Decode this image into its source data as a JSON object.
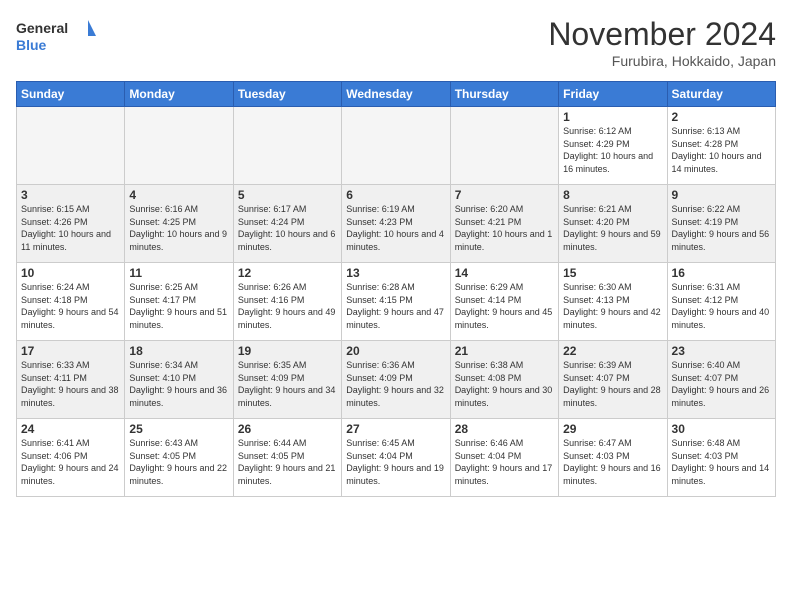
{
  "header": {
    "logo_line1": "General",
    "logo_line2": "Blue",
    "month": "November 2024",
    "location": "Furubira, Hokkaido, Japan"
  },
  "days_of_week": [
    "Sunday",
    "Monday",
    "Tuesday",
    "Wednesday",
    "Thursday",
    "Friday",
    "Saturday"
  ],
  "weeks": [
    [
      {
        "day": "",
        "info": ""
      },
      {
        "day": "",
        "info": ""
      },
      {
        "day": "",
        "info": ""
      },
      {
        "day": "",
        "info": ""
      },
      {
        "day": "",
        "info": ""
      },
      {
        "day": "1",
        "info": "Sunrise: 6:12 AM\nSunset: 4:29 PM\nDaylight: 10 hours and 16 minutes."
      },
      {
        "day": "2",
        "info": "Sunrise: 6:13 AM\nSunset: 4:28 PM\nDaylight: 10 hours and 14 minutes."
      }
    ],
    [
      {
        "day": "3",
        "info": "Sunrise: 6:15 AM\nSunset: 4:26 PM\nDaylight: 10 hours and 11 minutes."
      },
      {
        "day": "4",
        "info": "Sunrise: 6:16 AM\nSunset: 4:25 PM\nDaylight: 10 hours and 9 minutes."
      },
      {
        "day": "5",
        "info": "Sunrise: 6:17 AM\nSunset: 4:24 PM\nDaylight: 10 hours and 6 minutes."
      },
      {
        "day": "6",
        "info": "Sunrise: 6:19 AM\nSunset: 4:23 PM\nDaylight: 10 hours and 4 minutes."
      },
      {
        "day": "7",
        "info": "Sunrise: 6:20 AM\nSunset: 4:21 PM\nDaylight: 10 hours and 1 minute."
      },
      {
        "day": "8",
        "info": "Sunrise: 6:21 AM\nSunset: 4:20 PM\nDaylight: 9 hours and 59 minutes."
      },
      {
        "day": "9",
        "info": "Sunrise: 6:22 AM\nSunset: 4:19 PM\nDaylight: 9 hours and 56 minutes."
      }
    ],
    [
      {
        "day": "10",
        "info": "Sunrise: 6:24 AM\nSunset: 4:18 PM\nDaylight: 9 hours and 54 minutes."
      },
      {
        "day": "11",
        "info": "Sunrise: 6:25 AM\nSunset: 4:17 PM\nDaylight: 9 hours and 51 minutes."
      },
      {
        "day": "12",
        "info": "Sunrise: 6:26 AM\nSunset: 4:16 PM\nDaylight: 9 hours and 49 minutes."
      },
      {
        "day": "13",
        "info": "Sunrise: 6:28 AM\nSunset: 4:15 PM\nDaylight: 9 hours and 47 minutes."
      },
      {
        "day": "14",
        "info": "Sunrise: 6:29 AM\nSunset: 4:14 PM\nDaylight: 9 hours and 45 minutes."
      },
      {
        "day": "15",
        "info": "Sunrise: 6:30 AM\nSunset: 4:13 PM\nDaylight: 9 hours and 42 minutes."
      },
      {
        "day": "16",
        "info": "Sunrise: 6:31 AM\nSunset: 4:12 PM\nDaylight: 9 hours and 40 minutes."
      }
    ],
    [
      {
        "day": "17",
        "info": "Sunrise: 6:33 AM\nSunset: 4:11 PM\nDaylight: 9 hours and 38 minutes."
      },
      {
        "day": "18",
        "info": "Sunrise: 6:34 AM\nSunset: 4:10 PM\nDaylight: 9 hours and 36 minutes."
      },
      {
        "day": "19",
        "info": "Sunrise: 6:35 AM\nSunset: 4:09 PM\nDaylight: 9 hours and 34 minutes."
      },
      {
        "day": "20",
        "info": "Sunrise: 6:36 AM\nSunset: 4:09 PM\nDaylight: 9 hours and 32 minutes."
      },
      {
        "day": "21",
        "info": "Sunrise: 6:38 AM\nSunset: 4:08 PM\nDaylight: 9 hours and 30 minutes."
      },
      {
        "day": "22",
        "info": "Sunrise: 6:39 AM\nSunset: 4:07 PM\nDaylight: 9 hours and 28 minutes."
      },
      {
        "day": "23",
        "info": "Sunrise: 6:40 AM\nSunset: 4:07 PM\nDaylight: 9 hours and 26 minutes."
      }
    ],
    [
      {
        "day": "24",
        "info": "Sunrise: 6:41 AM\nSunset: 4:06 PM\nDaylight: 9 hours and 24 minutes."
      },
      {
        "day": "25",
        "info": "Sunrise: 6:43 AM\nSunset: 4:05 PM\nDaylight: 9 hours and 22 minutes."
      },
      {
        "day": "26",
        "info": "Sunrise: 6:44 AM\nSunset: 4:05 PM\nDaylight: 9 hours and 21 minutes."
      },
      {
        "day": "27",
        "info": "Sunrise: 6:45 AM\nSunset: 4:04 PM\nDaylight: 9 hours and 19 minutes."
      },
      {
        "day": "28",
        "info": "Sunrise: 6:46 AM\nSunset: 4:04 PM\nDaylight: 9 hours and 17 minutes."
      },
      {
        "day": "29",
        "info": "Sunrise: 6:47 AM\nSunset: 4:03 PM\nDaylight: 9 hours and 16 minutes."
      },
      {
        "day": "30",
        "info": "Sunrise: 6:48 AM\nSunset: 4:03 PM\nDaylight: 9 hours and 14 minutes."
      }
    ]
  ]
}
